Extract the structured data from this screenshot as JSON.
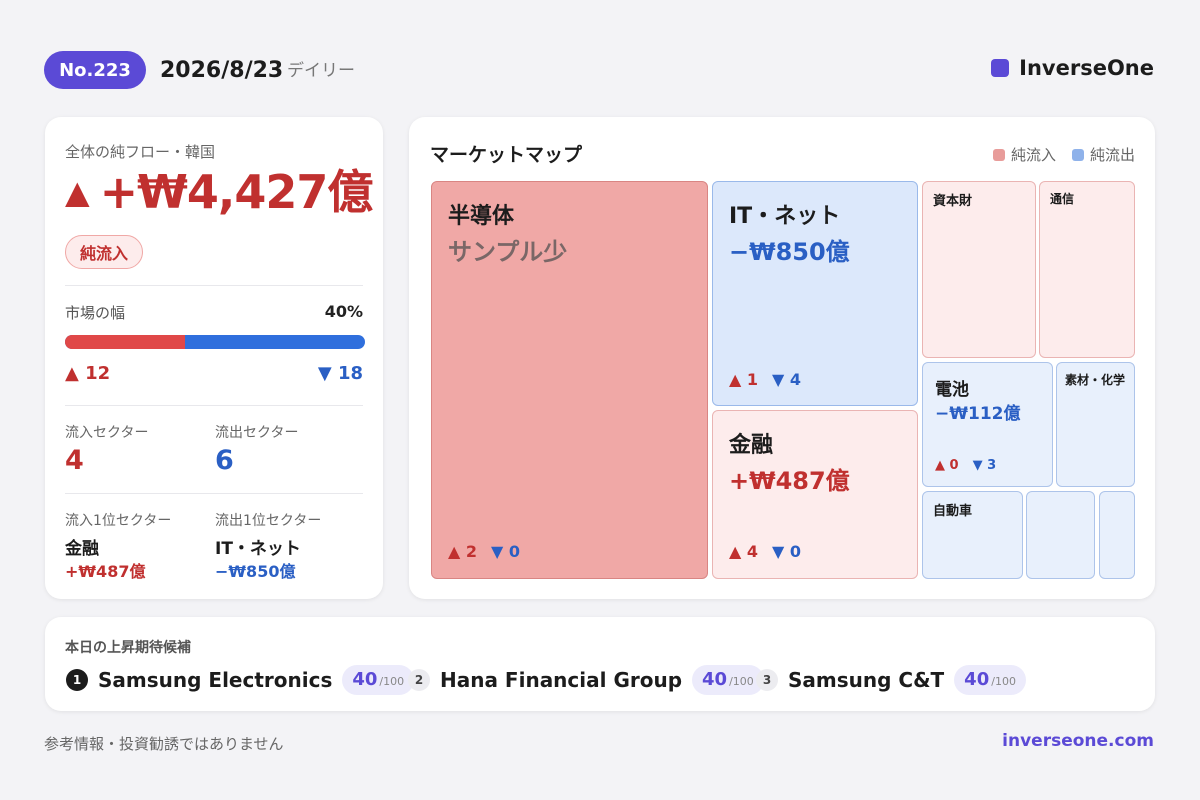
{
  "header": {
    "issue": "No.223",
    "date": "2026/8/23",
    "frequency": "デイリー",
    "brand": "InverseOne",
    "brand_color": "#5b4ad6"
  },
  "summary": {
    "title": "全体の純フロー・韓国",
    "arrow": "▲",
    "total_flow": "+₩4,427億",
    "direction_badge": "純流入",
    "breadth_label": "市場の幅",
    "breadth_pct": "40%",
    "breadth_fraction": 0.4,
    "up_label": "▲ 12",
    "down_label": "▼ 18",
    "inflow_sectors_label": "流入セクター",
    "inflow_sectors": "4",
    "outflow_sectors_label": "流出セクター",
    "outflow_sectors": "6",
    "top_inflow_label": "流入1位セクター",
    "top_inflow_name": "金融",
    "top_inflow_value": "+₩487億",
    "top_outflow_label": "流出1位セクター",
    "top_outflow_name": "IT・ネット",
    "top_outflow_value": "−₩850億"
  },
  "market_map": {
    "title": "マーケットマップ",
    "legend_in": "純流入",
    "legend_out": "純流出",
    "legend_in_color": "#e89c9a",
    "legend_out_color": "#8fb2ea",
    "tiles": {
      "semis": {
        "name": "半導体",
        "value": "サンプル少",
        "up": "▲ 2",
        "down": "▼ 0"
      },
      "it": {
        "name": "IT・ネット",
        "value": "−₩850億",
        "up": "▲ 1",
        "down": "▼ 4"
      },
      "finance": {
        "name": "金融",
        "value": "+₩487億",
        "up": "▲ 4",
        "down": "▼ 0"
      },
      "capital_goods": {
        "name": "資本財"
      },
      "telecom": {
        "name": "通信"
      },
      "battery": {
        "name": "電池",
        "value": "−₩112億",
        "up": "▲ 0",
        "down": "▼ 3"
      },
      "materials": {
        "name": "素材・化学"
      },
      "auto": {
        "name": "自動車"
      }
    }
  },
  "picks": {
    "title": "本日の上昇期待候補",
    "items": [
      {
        "rank": "1",
        "name": "Samsung Electronics",
        "score": "40",
        "max": "/100"
      },
      {
        "rank": "2",
        "name": "Hana Financial Group",
        "score": "40",
        "max": "/100"
      },
      {
        "rank": "3",
        "name": "Samsung C&T",
        "score": "40",
        "max": "/100"
      }
    ]
  },
  "footer": {
    "disclaimer": "参考情報・投資勧誘ではありません",
    "site": "inverseone.com"
  }
}
